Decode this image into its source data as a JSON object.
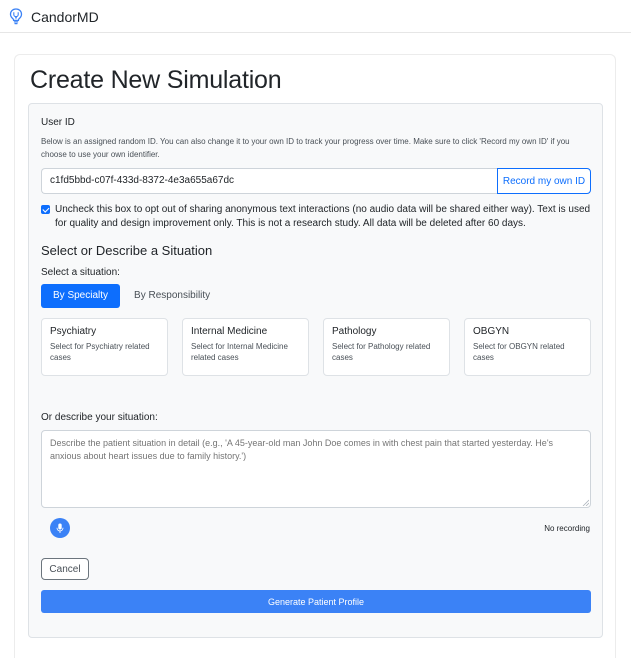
{
  "app": {
    "brand": "CandorMD",
    "brand_icon": "lightbulb-stethoscope-icon",
    "accent": "#3b82f6"
  },
  "page": {
    "title": "Create New Simulation"
  },
  "user_id": {
    "label": "User ID",
    "help": "Below is an assigned random ID. You can also change it to your own ID to track your progress over time. Make sure to click 'Record my own ID' if you choose to use your own identifier.",
    "value": "c1fd5bbd-c07f-433d-8372-4e3a655a67dc",
    "button_label": "Record my own ID"
  },
  "opt_out": {
    "checked": true,
    "text": "Uncheck this box to opt out of sharing anonymous text interactions (no audio data will be shared either way). Text is used for quality and design improvement only. This is not a research study. All data will be deleted after 60 days."
  },
  "situation": {
    "title": "Select or Describe a Situation",
    "select_label": "Select a situation:",
    "tabs": [
      {
        "label": "By Specialty",
        "active": true
      },
      {
        "label": "By Responsibility",
        "active": false
      }
    ],
    "specialties": [
      {
        "name": "Psychiatry",
        "desc": "Select for Psychiatry related cases"
      },
      {
        "name": "Internal Medicine",
        "desc": "Select for Internal Medicine related cases"
      },
      {
        "name": "Pathology",
        "desc": "Select for Pathology related cases"
      },
      {
        "name": "OBGYN",
        "desc": "Select for OBGYN related cases"
      }
    ],
    "describe_label": "Or describe your situation:",
    "describe_placeholder": "Describe the patient situation in detail (e.g., 'A 45-year-old man John Doe comes in with chest pain that started yesterday. He's anxious about heart issues due to family history.')",
    "mic_icon": "microphone-icon",
    "recording_status": "No recording"
  },
  "actions": {
    "cancel_label": "Cancel",
    "generate_label": "Generate Patient Profile"
  }
}
